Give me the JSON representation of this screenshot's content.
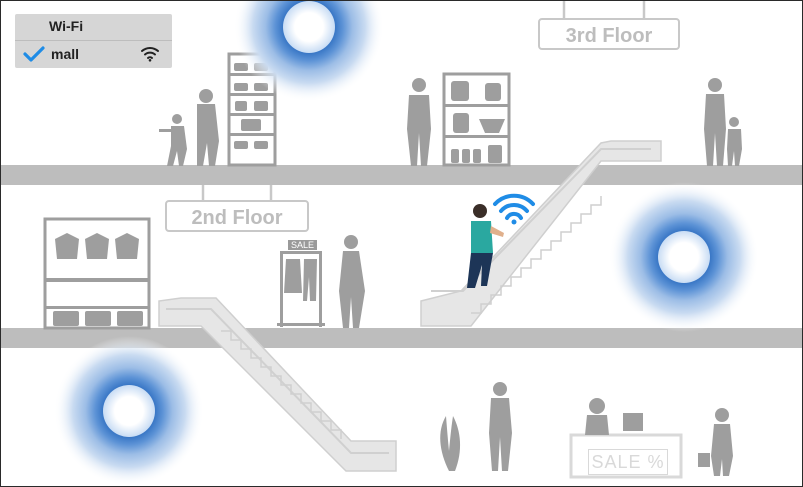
{
  "wifi_panel": {
    "title": "Wi-Fi",
    "network": {
      "ssid": "mall",
      "connected": true
    },
    "icons": {
      "connected": "checkmark-icon",
      "signal": "wifi-signal-icon"
    }
  },
  "floor_signs": {
    "third": "3rd Floor",
    "second": "2nd Floor"
  },
  "labels": {
    "rack_sale": "SALE",
    "counter_sale": "SALE %"
  },
  "colors": {
    "accent": "#1f8ce6",
    "floor": "#bdbdbd",
    "silhouette": "#9e9e9e",
    "escalator": "#e6e6e6",
    "shopper_shirt": "#2aa8a0",
    "shopper_pants": "#1d3557"
  }
}
